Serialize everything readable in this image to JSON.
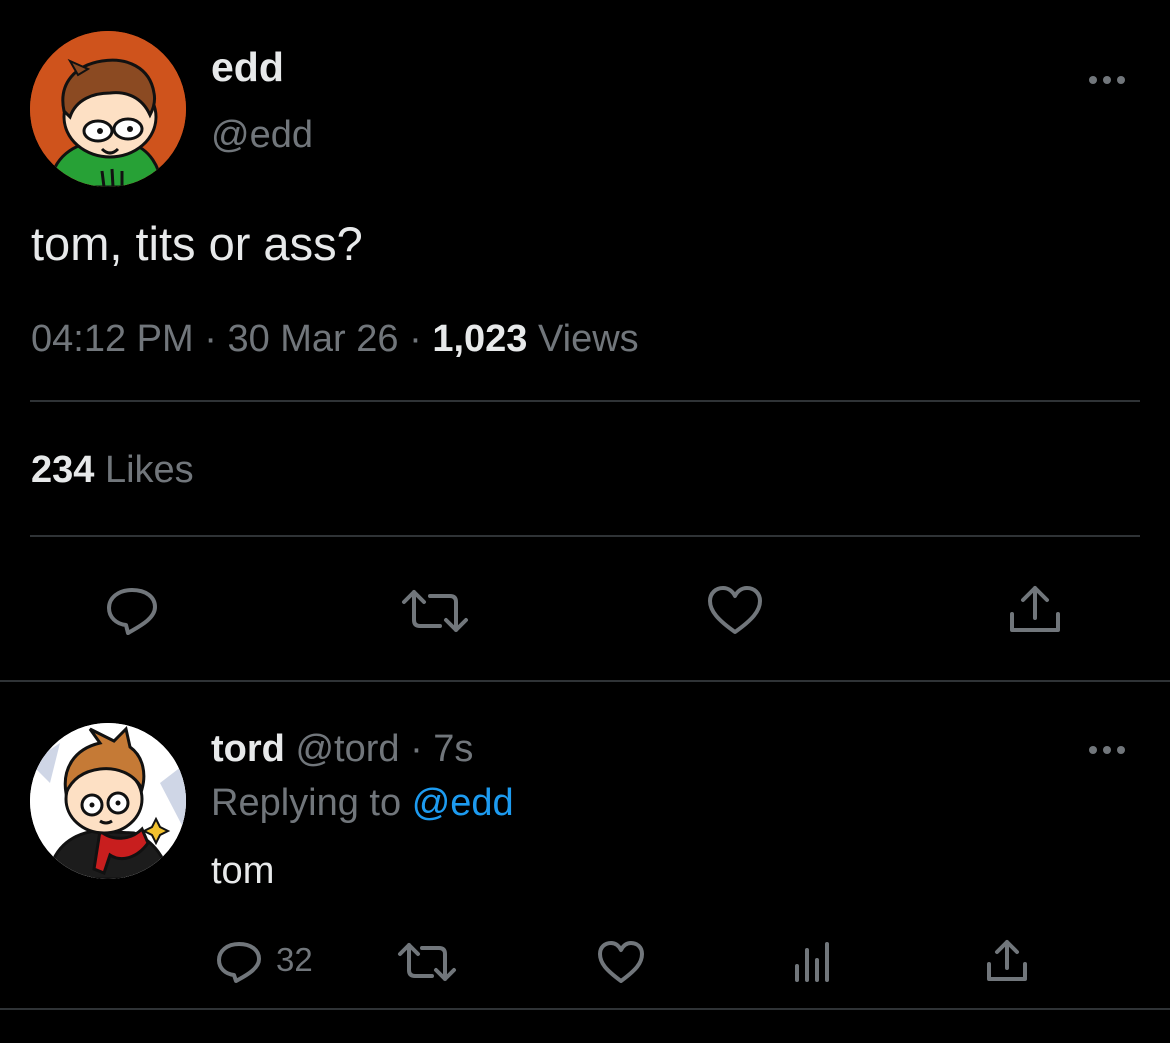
{
  "main_tweet": {
    "display_name": "edd",
    "handle": "@edd",
    "text": "tom, tits or ass?",
    "time": "04:12 PM",
    "date": "30 Mar 26",
    "separator": "·",
    "views_count": "1,023",
    "views_label": "Views",
    "likes_count": "234",
    "likes_label": "Likes",
    "icons": [
      "more-icon",
      "reply-icon",
      "retweet-icon",
      "like-icon",
      "share-icon"
    ]
  },
  "reply_tweet": {
    "display_name": "tord",
    "handle": "@tord",
    "separator": "·",
    "time_ago": "7s",
    "replying_prefix": "Replying to",
    "replying_handle": "@edd",
    "text": "tom",
    "reply_count": "32",
    "icons": [
      "more-icon",
      "reply-icon",
      "retweet-icon",
      "like-icon",
      "views-icon",
      "share-icon"
    ]
  },
  "colors": {
    "background": "#000000",
    "primary_text": "#e7e9ea",
    "secondary_text": "#71767b",
    "accent_link": "#1d9bf0",
    "divider": "#2f3336"
  }
}
